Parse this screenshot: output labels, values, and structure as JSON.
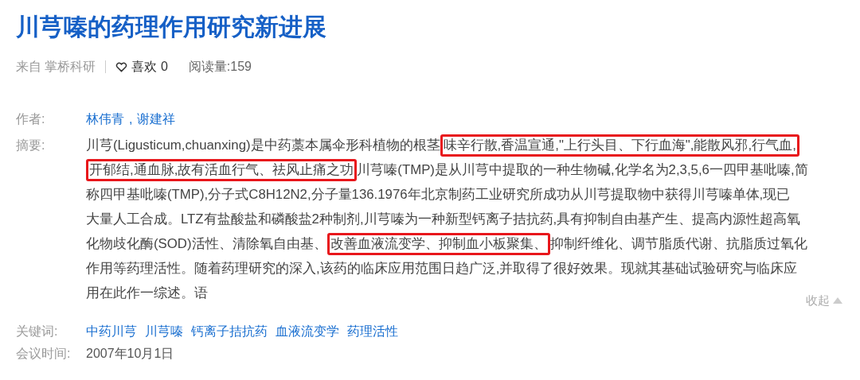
{
  "title": "川芎嗪的药理作用研究新进展",
  "meta": {
    "source": "来自 掌桥科研",
    "likes": "喜欢 0",
    "reads": "阅读量:159"
  },
  "authors": {
    "label": "作者:",
    "names": [
      "林伟青",
      "谢建祥"
    ],
    "separator": ","
  },
  "abstract": {
    "label": "摘要:",
    "lines": [
      [
        {
          "text": "川芎(Ligusticum,chuanxing)是中药藁本属伞形科植物的根茎",
          "highlighted": false
        },
        {
          "text": "味辛行散,香温宣通,\"上行头目、下行血海\",能散风邪,行气血,",
          "highlighted": true
        }
      ],
      [
        {
          "text": "开郁结,通血脉,故有活血行气、祛风止痛之功",
          "highlighted": true
        },
        {
          "text": "川芎嗪(TMP)是从川芎中提取的一种生物碱,化学名为2,3,5,6一四甲基吡嗪,简",
          "highlighted": false
        }
      ],
      [
        {
          "text": "称四甲基吡嗪(TMP),分子式C8H12N2,分子量136.1976年北京制药工业研究所成功从川芎提取物中获得川芎嗪单体,现已",
          "highlighted": false
        }
      ],
      [
        {
          "text": "大量人工合成。LTZ有盐酸盐和磷酸盐2种制剂,川芎嗪为一种新型钙离子拮抗药,具有抑制自由基产生、提高内源性超高氧",
          "highlighted": false
        }
      ],
      [
        {
          "text": "化物歧化酶(SOD)活性、清除氧自由基、",
          "highlighted": false
        },
        {
          "text": "改善血液流变学、抑制血小板聚集、",
          "highlighted": true
        },
        {
          "text": "抑制纤维化、调节脂质代谢、抗脂质过氧化",
          "highlighted": false
        }
      ],
      [
        {
          "text": "作用等药理活性。随着药理研究的深入,该药的临床应用范围日趋广泛,并取得了很好效果。现就其基础试验研究与临床应",
          "highlighted": false
        }
      ],
      [
        {
          "text": "用在此作一综述。语",
          "highlighted": false
        }
      ]
    ],
    "collapse": "收起"
  },
  "keywords": {
    "label": "关键词:",
    "items": [
      "中药川芎",
      "川芎嗪",
      "钙离子拮抗药",
      "血液流变学",
      "药理活性"
    ]
  },
  "meeting": {
    "label": "会议时间:",
    "value": "2007年10月1日"
  }
}
